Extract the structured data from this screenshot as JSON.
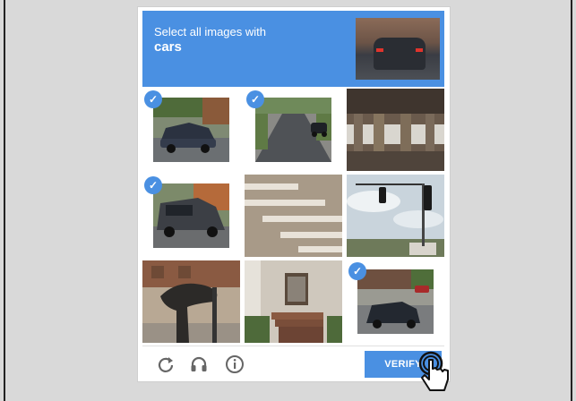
{
  "captcha": {
    "prompt_line1": "Select all images with",
    "prompt_target": "cars",
    "tiles": [
      {
        "row": 0,
        "col": 0,
        "selected": true,
        "content": "car"
      },
      {
        "row": 0,
        "col": 1,
        "selected": true,
        "content": "car"
      },
      {
        "row": 0,
        "col": 2,
        "selected": false,
        "content": "overpass"
      },
      {
        "row": 1,
        "col": 0,
        "selected": true,
        "content": "car"
      },
      {
        "row": 1,
        "col": 1,
        "selected": false,
        "content": "crosswalk"
      },
      {
        "row": 1,
        "col": 2,
        "selected": false,
        "content": "traffic-light"
      },
      {
        "row": 2,
        "col": 0,
        "selected": false,
        "content": "statue"
      },
      {
        "row": 2,
        "col": 1,
        "selected": false,
        "content": "house"
      },
      {
        "row": 2,
        "col": 2,
        "selected": true,
        "content": "car"
      }
    ],
    "check_glyph": "✓",
    "verify_label": "VERIFY",
    "icons": {
      "reload": "reload-icon",
      "audio": "headphones-icon",
      "info": "info-icon"
    },
    "colors": {
      "accent": "#4a90e2",
      "white": "#ffffff"
    }
  }
}
